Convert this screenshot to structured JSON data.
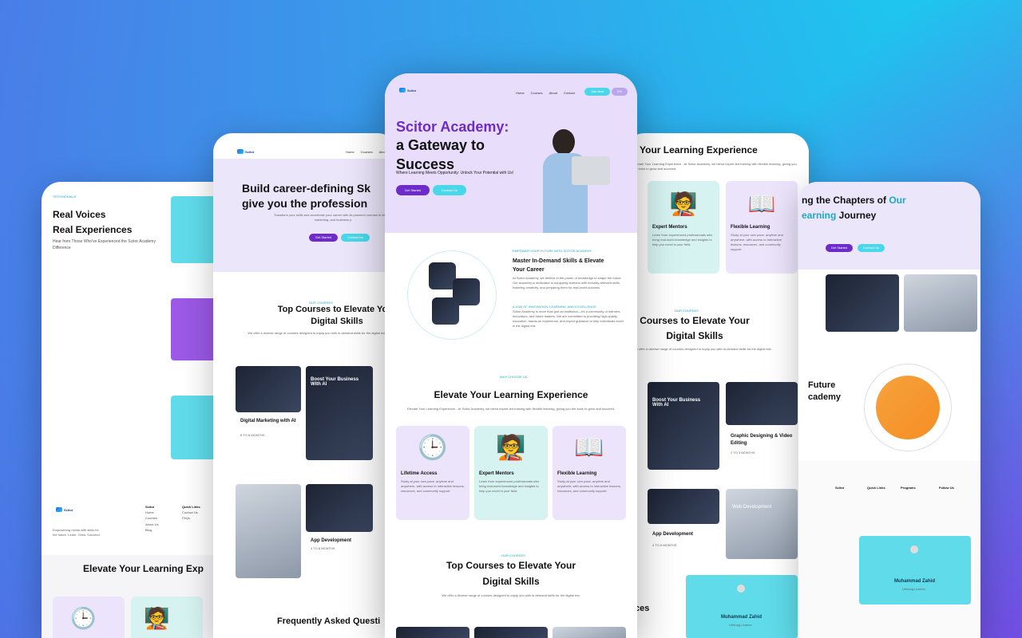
{
  "brand": {
    "name_line1": "Scitor",
    "name_line2": "Academy"
  },
  "nav": {
    "home": "Home",
    "courses": "Courses",
    "about": "About",
    "contact": "Contact",
    "cta": "Join Now",
    "toggle": "EN"
  },
  "hero": {
    "title_line1": "Scitor Academy:",
    "title_line2": "a Gateway to",
    "title_line3": "Success",
    "subtitle": "Where Learning Meets Opportunity: Unlock Your Potential with Us!",
    "get_started": "Get Started",
    "contact_us": "Contact Us"
  },
  "master": {
    "eyebrow": "EMPOWER YOUR FUTURE WITH SCITOR ACADEMY",
    "title_line1": "Master In-Demand Skills & Elevate",
    "title_line2": "Your Career",
    "p1": "At Scitor Academy, we believe in the power of knowledge to shape the future. Our academy is dedicated to equipping learners with industry-relevant skills, fostering creativity, and preparing them for real-world success.",
    "eyebrow2": "A HUB OF INNOVATION, LEARNING, AND EXCELLENCE",
    "p2": "Scitor Academy is more than just an institution—it's a community of learners, innovators, and future leaders. We are committed to providing high-quality education, hands-on experience, and expert guidance to help individuals excel in the digital era."
  },
  "elevate": {
    "eyebrow": "WHY CHOOSE US",
    "title": "Elevate Your Learning Experience",
    "desc": "Elevate Your Learning Experience - At Scitor Academy, we blend expert-led training with flexible learning, giving you the tools to grow and succeed.",
    "features": [
      {
        "title": "Lifetime Access",
        "desc": "Study at your own pace, anytime and anywhere, with access to interactive lessons, resources, and community support."
      },
      {
        "title": "Expert Mentors",
        "desc": "Learn from experienced professionals who bring real-world knowledge and insights to help you excel in your field."
      },
      {
        "title": "Flexible Learning",
        "desc": "Study at your own pace, anytime and anywhere, with access to interactive lessons, resources, and community support."
      }
    ]
  },
  "courses": {
    "eyebrow": "OUR COURSES",
    "title_line1": "Top Courses to Elevate Your",
    "title_line2": "Digital Skills",
    "desc": "We offer a diverse range of courses designed to equip you with in-demand skills for the digital era."
  },
  "left_card": {
    "eyebrow": "TESTIMONIALS",
    "title_line1": "Real Voices",
    "title_line2": "Real Experiences",
    "desc": "Hear from Those Who've Experienced the Scitor Academy Difference",
    "footer_tagline": "Empowering minds with skills for the future. Learn. Grow. Succeed.",
    "footer_col1": "Scitor",
    "footer_links_title": "Quick Links",
    "footer_col1_items": [
      "Home",
      "Courses",
      "About Us",
      "Blog"
    ],
    "footer_col2_items": [
      "Contact Us",
      "FAQs"
    ],
    "bottom_title": "Elevate Your Learning Exp"
  },
  "card2": {
    "title_line1": "Build career-defining Sk",
    "title_line2": "give you the profession",
    "desc": "Transform your skills and accelerate your career with AI-powered courses in design, marketing, and business p",
    "course1": "Digital Marketing with AI",
    "course1_duration": "6 TO 8 MONTHS",
    "course1_overlay": "Boost Your Business With AI",
    "course2": "App Development",
    "course2_duration": "4 TO 6 MONTHS",
    "faq": "Frequently Asked Questi"
  },
  "card4": {
    "title": "Your Learning Experience",
    "expert": "Expert Mentors",
    "flex": "Flexible Learning",
    "courses_title_line1": "Courses to Elevate Your",
    "courses_title_line2": "Digital Skills",
    "course_a": "Graphic Designing & Video Editing",
    "course_a_duration": "2 TO 3 MONTHS",
    "course_b": "App Development",
    "course_b_duration": "4 TO 6 MONTHS",
    "overlay": "Boost Your Business With AI",
    "web_dev": "Web Development",
    "testimonial_name": "Muhammad Zahid",
    "testimonial_role": "Lifelong Learner",
    "ces": "ces"
  },
  "card5": {
    "title_line1": "ng the Chapters of ",
    "title_accent1": "Our",
    "title_line2_accent": "earning",
    "title_line2": " Journey",
    "future_line1": "Future",
    "future_line2": "cademy",
    "footer_programs": "Programs",
    "footer_follow": "Follow Us",
    "testimonial_name": "Muhammad Zahid",
    "testimonial_role": "Lifelong Learner"
  }
}
